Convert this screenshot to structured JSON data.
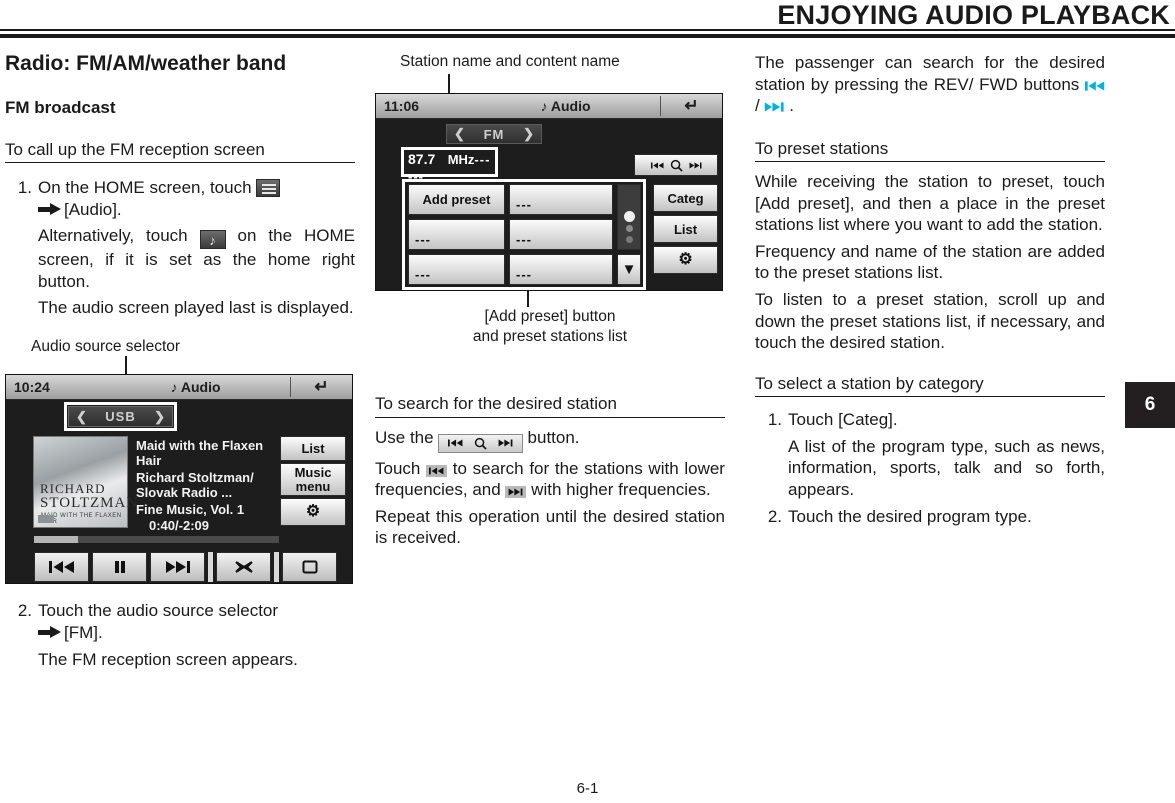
{
  "header": {
    "title": "ENJOYING AUDIO PLAYBACK",
    "chapter_tab": "6"
  },
  "footer": {
    "page_number": "6-1"
  },
  "col1": {
    "section_title": "Radio: FM/AM/weather band",
    "subsection_title": "FM broadcast",
    "heading_1": "To call up the FM reception screen",
    "step1": {
      "num": "1.",
      "text_a": "On the HOME screen, touch",
      "text_b": "[Audio].",
      "menu_icon": "hamburger-menu-icon",
      "arrow_icon": "right-arrow-icon"
    },
    "step1_alt_a": "Alternatively, touch",
    "step1_alt_b": "on the HOME screen, if it is set as the home right button.",
    "step1_note": "The audio screen played last is displayed.",
    "caption_audio_source": "Audio source selector",
    "step2": {
      "num": "2.",
      "text_a": "Touch the audio source selector",
      "text_b": "[FM]."
    },
    "step2_note": "The FM reception screen appears."
  },
  "audio_screen": {
    "clock": "10:24",
    "title": "Audio",
    "note_icon": "music-note-icon",
    "back_icon": "back-arrow-icon",
    "source": "USB",
    "prev_chevron": "❮",
    "next_chevron": "❯",
    "album": {
      "artist_line1": "RICHARD",
      "artist_line2": "STOLTZMAN",
      "sub": "MAID WITH THE FLAXEN HAIR"
    },
    "track_title": "Maid with the Flaxen Hair",
    "track_artist": "Richard Stoltzman/ Slovak Radio ...",
    "track_album": "Fine Music, Vol. 1",
    "track_time": "0:40/-2:09",
    "buttons": {
      "list": "List",
      "music_menu": "Music menu",
      "settings_icon": "gear-icon"
    },
    "controls": {
      "prev": "prev-track-icon",
      "pause": "pause-icon",
      "next": "next-track-icon",
      "shuffle": "shuffle-icon",
      "repeat": "repeat-icon"
    }
  },
  "col2": {
    "caption_top": "Station name and content name",
    "caption_bottom_line1": "[Add preset] button",
    "caption_bottom_line2": "and preset stations list",
    "heading_search": "To search for the desired station",
    "use_the_a": "Use the",
    "use_the_b": "button.",
    "touch_a": "Touch",
    "touch_b": "to search for the stations with lower frequencies, and",
    "touch_c": "with higher frequencies.",
    "repeat_text": "Repeat this operation until the desired station is received."
  },
  "radio_screen": {
    "clock": "11:06",
    "title": "Audio",
    "note_icon": "music-note-icon",
    "back_icon": "back-arrow-icon",
    "source": "FM",
    "prev_chevron": "❮",
    "next_chevron": "❯",
    "frequency": "87.7",
    "unit": "MHz",
    "station_name_placeholder": "---",
    "content_name_placeholder": "---",
    "search_bar": {
      "prev_icon": "search-prev-icon",
      "search_icon": "magnifier-icon",
      "next_icon": "search-next-icon"
    },
    "preset_list": [
      {
        "label": "Add preset",
        "kind": "button"
      },
      {
        "label": "---",
        "kind": "empty"
      },
      {
        "label": "---",
        "kind": "empty"
      },
      {
        "label": "---",
        "kind": "empty"
      },
      {
        "label": "---",
        "kind": "empty"
      },
      {
        "label": "---",
        "kind": "empty"
      }
    ],
    "side_buttons": {
      "categ": "Categ",
      "list": "List",
      "settings_icon": "gear-icon"
    },
    "scroll_down_icon": "scroll-down-arrow-icon"
  },
  "col3": {
    "passenger_text_a": "The passenger can search for the desired station by pressing the REV/ FWD buttons",
    "passenger_text_b": "/",
    "passenger_text_c": ".",
    "heading_preset": "To preset stations",
    "preset_p1": "While receiving the station to preset, touch [Add preset], and then a place in the preset stations list where you want to add the station.",
    "preset_p2": "Frequency and name of the station are added to the preset stations list.",
    "preset_p3": "To listen to a preset station, scroll up and down the preset stations list, if necessary, and touch the desired station.",
    "heading_category": "To select a station by category",
    "cat_step1_num": "1.",
    "cat_step1": "Touch [Categ].",
    "cat_step1_note": "A list of the program type, such as news, information, sports, talk and so forth, appears.",
    "cat_step2_num": "2.",
    "cat_step2": "Touch the desired program type."
  },
  "colors": {
    "ink": "#1a1a1a",
    "tab": "#231f20",
    "cyan": "#00b2e3"
  }
}
